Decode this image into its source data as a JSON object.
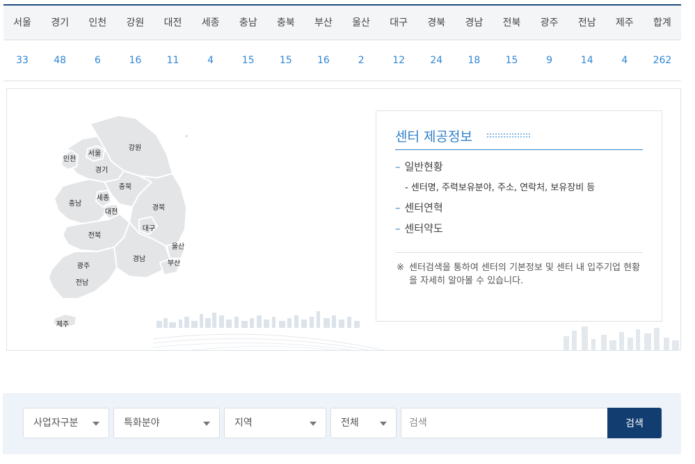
{
  "stats": {
    "regions": [
      "서울",
      "경기",
      "인천",
      "강원",
      "대전",
      "세종",
      "충남",
      "충북",
      "부산",
      "울산",
      "대구",
      "경북",
      "경남",
      "전북",
      "광주",
      "전남",
      "제주",
      "합계"
    ],
    "counts": [
      "33",
      "48",
      "6",
      "16",
      "11",
      "4",
      "15",
      "15",
      "16",
      "2",
      "12",
      "24",
      "18",
      "15",
      "9",
      "14",
      "4",
      "262"
    ]
  },
  "map": {
    "labels": {
      "seoul": "서울",
      "incheon": "인천",
      "gyeonggi": "경기",
      "gangwon": "강원",
      "chungbuk": "충북",
      "chungnam": "충남",
      "sejong": "세종",
      "daejeon": "대전",
      "gyeongbuk": "경북",
      "daegu": "대구",
      "jeonbuk": "전북",
      "ulsan": "울산",
      "gyeongnam": "경남",
      "busan": "부산",
      "gwangju": "광주",
      "jeonnam": "전남",
      "jeju": "제주"
    }
  },
  "info": {
    "title": "센터 제공정보",
    "items": [
      "일반현황",
      "센터연혁",
      "센터약도"
    ],
    "sub": "- 센터명, 주력보유분야, 주소, 연락처, 보유장비 등",
    "note_mark": "※",
    "note": "센터검색을 통하여 센터의 기본정보 및 센터 내 입주기업 현황을 자세히 알아볼 수 있습니다."
  },
  "search": {
    "selects": [
      "사업자구분",
      "특화분야",
      "지역",
      "전체"
    ],
    "placeholder": "검색",
    "button": "검색"
  },
  "colors": {
    "accent": "#2f86d6",
    "navy": "#123d70",
    "header_bg": "#f4f5f7",
    "bar_bg": "#eef3fa"
  }
}
